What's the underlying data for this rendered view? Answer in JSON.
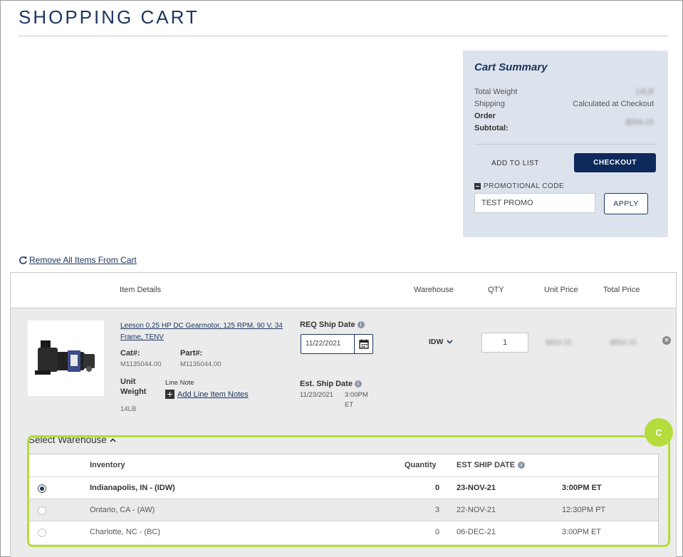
{
  "page": {
    "title": "SHOPPING CART"
  },
  "summary": {
    "title": "Cart Summary",
    "total_weight_label": "Total Weight",
    "total_weight_value": "14LB",
    "shipping_label": "Shipping",
    "shipping_value": "Calculated at Checkout",
    "order_label": "Order",
    "subtotal_label": "Subtotal:",
    "subtotal_value": "$554.15",
    "add_to_list": "ADD TO LIST",
    "checkout": "CHECKOUT",
    "promo_label": "PROMOTIONAL CODE",
    "promo_value": "TEST PROMO",
    "apply": "APPLY"
  },
  "remove_all": "Remove All Items From Cart",
  "table": {
    "headers": {
      "item_details": "Item Details",
      "warehouse": "Warehouse",
      "qty": "QTY",
      "unit_price": "Unit Price",
      "total_price": "Total Price"
    }
  },
  "item": {
    "name": "Leeson 0.25 HP DC Gearmotor, 125 RPM, 90 V, 34 Frame, TENV",
    "cat_label": "Cat#:",
    "cat_value": "M1135044.00",
    "part_label": "Part#:",
    "part_value": "M1135044.00",
    "unit_weight_label_1": "Unit",
    "unit_weight_label_2": "Weight",
    "unit_weight_value": "14LB",
    "line_note_label": "Line Note",
    "add_line_notes": "Add Line Item Notes",
    "req_ship_label": "REQ Ship Date",
    "req_ship_value": "11/22/2021",
    "est_ship_label": "Est. Ship Date",
    "est_ship_date": "11/23/2021",
    "est_ship_time_1": "3:00PM",
    "est_ship_time_2": "ET",
    "warehouse": "IDW",
    "qty": "1",
    "unit_price": "$554.15",
    "total_price": "$554.15"
  },
  "warehouse_section": {
    "title": "Select Warehouse",
    "badge": "C",
    "headers": {
      "inventory": "Inventory",
      "quantity": "Quantity",
      "est_ship_date": "EST SHIP DATE"
    },
    "rows": [
      {
        "name": "Indianapolis, IN - (IDW)",
        "quantity": "0",
        "date": "23-NOV-21",
        "time": "3:00PM ET",
        "selected": true
      },
      {
        "name": "Ontario, CA - (AW)",
        "quantity": "3",
        "date": "22-NOV-21",
        "time": "12:30PM PT",
        "selected": false
      },
      {
        "name": "Charlotte, NC - (BC)",
        "quantity": "0",
        "date": "06-DEC-21",
        "time": "3:00PM ET",
        "selected": false
      }
    ]
  },
  "colors": {
    "brand_navy": "#1d3660",
    "checkout_bg": "#0e2a5c",
    "summary_bg": "#dde3ec",
    "highlight_green": "#b5dc3c"
  }
}
